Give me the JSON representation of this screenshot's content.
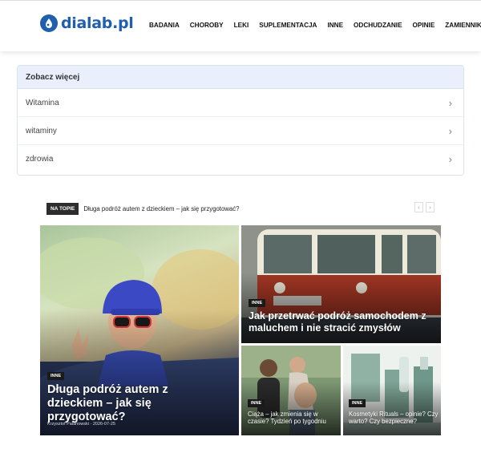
{
  "header": {
    "logo_text": "dialab.pl",
    "nav": [
      "BADANIA",
      "CHOROBY",
      "LEKI",
      "SUPLEMENTACJA",
      "INNE",
      "ODCHUDZANIE",
      "OPINIE",
      "ZAMIENNIKI"
    ]
  },
  "more": {
    "heading": "Zobacz więcej",
    "items": [
      {
        "label": "Witamina"
      },
      {
        "label": "witaminy"
      },
      {
        "label": "zdrowia"
      }
    ]
  },
  "ticker": {
    "badge": "NA TOPIE",
    "headline": "Długa podróż autem z dzieckiem – jak się przygotować?"
  },
  "articles": [
    {
      "category": "INNE",
      "title": "Długa podróż autem z dzieckiem – jak się przygotować?",
      "author": "Krzysztof Palanowski",
      "date": "2026-07-25"
    },
    {
      "category": "INNE",
      "title": "Jak przetrwać podróż samochodem z maluchem i nie stracić zmysłów"
    },
    {
      "category": "INNE",
      "title": "Ciąża – jak zmienia się w czasie? Tydzień po tygodniu"
    },
    {
      "category": "INNE",
      "title": "Kosmetyki Rituals – opinie? Czy warto? Czy bezpieczne?"
    }
  ],
  "colors": {
    "brand": "#1f5fae",
    "more_head_bg": "#eaf0fb",
    "badge_bg": "#1a1a1a"
  },
  "icons": {
    "logo": "water-drop-icon",
    "chevron": "chevron-right-icon",
    "prev": "arrow-left-icon",
    "next": "arrow-right-icon"
  }
}
